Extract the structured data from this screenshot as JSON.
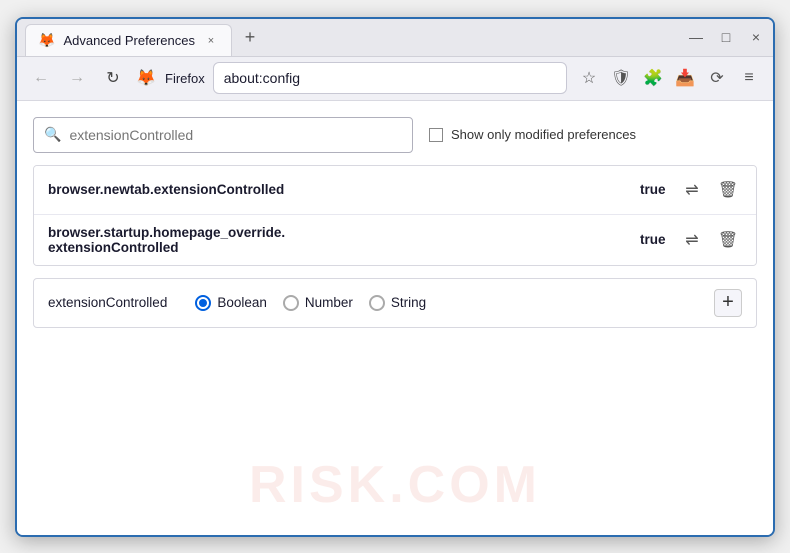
{
  "window": {
    "title": "Advanced Preferences",
    "tab_close": "×",
    "tab_new": "+",
    "win_minimize": "—",
    "win_maximize": "□",
    "win_close": "×"
  },
  "navbar": {
    "back_icon": "←",
    "forward_icon": "→",
    "refresh_icon": "↻",
    "browser_name": "Firefox",
    "address": "about:config",
    "bookmark_icon": "☆",
    "shield_icon": "🛡",
    "extension_icon": "🧩",
    "download_icon": "📥",
    "sync_icon": "⟳",
    "menu_icon": "≡"
  },
  "search": {
    "placeholder": "extensionControlled",
    "value": "extensionControlled",
    "show_modified_label": "Show only modified preferences"
  },
  "results": [
    {
      "name": "browser.newtab.extensionControlled",
      "value": "true"
    },
    {
      "name_line1": "browser.startup.homepage_override.",
      "name_line2": "extensionControlled",
      "value": "true"
    }
  ],
  "new_pref": {
    "name": "extensionControlled",
    "types": [
      "Boolean",
      "Number",
      "String"
    ],
    "selected_type": "Boolean",
    "add_label": "+"
  },
  "watermark": "RISK.COM"
}
